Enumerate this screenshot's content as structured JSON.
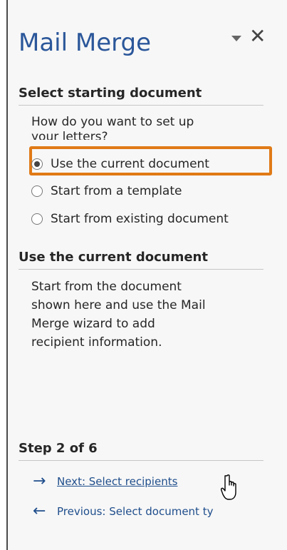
{
  "pane": {
    "title": "Mail Merge",
    "icons": {
      "dropdown": "chevron-down-icon",
      "close": "close-icon",
      "close_glyph": "✕"
    }
  },
  "select_starting_document": {
    "heading": "Select starting document",
    "question_line1": "How do you want to set up",
    "question_line2": "your letters?",
    "options": [
      {
        "label": "Use the current document",
        "checked": true
      },
      {
        "label": "Start from a template",
        "checked": false
      },
      {
        "label": "Start from existing document",
        "checked": false
      }
    ]
  },
  "use_current_document": {
    "heading": "Use the current document",
    "lines": [
      "Start from the document",
      "shown here and use the Mail",
      "Merge wizard to add",
      "recipient information."
    ]
  },
  "step": {
    "label": "Step 2 of 6",
    "next": {
      "arrow": "→",
      "text": "Next: Select recipients"
    },
    "previous": {
      "arrow": "←",
      "text": "Previous: Select document ty"
    }
  },
  "colors": {
    "title": "#2b579a",
    "highlight": "#e07a16",
    "link": "#1f4e8c"
  }
}
